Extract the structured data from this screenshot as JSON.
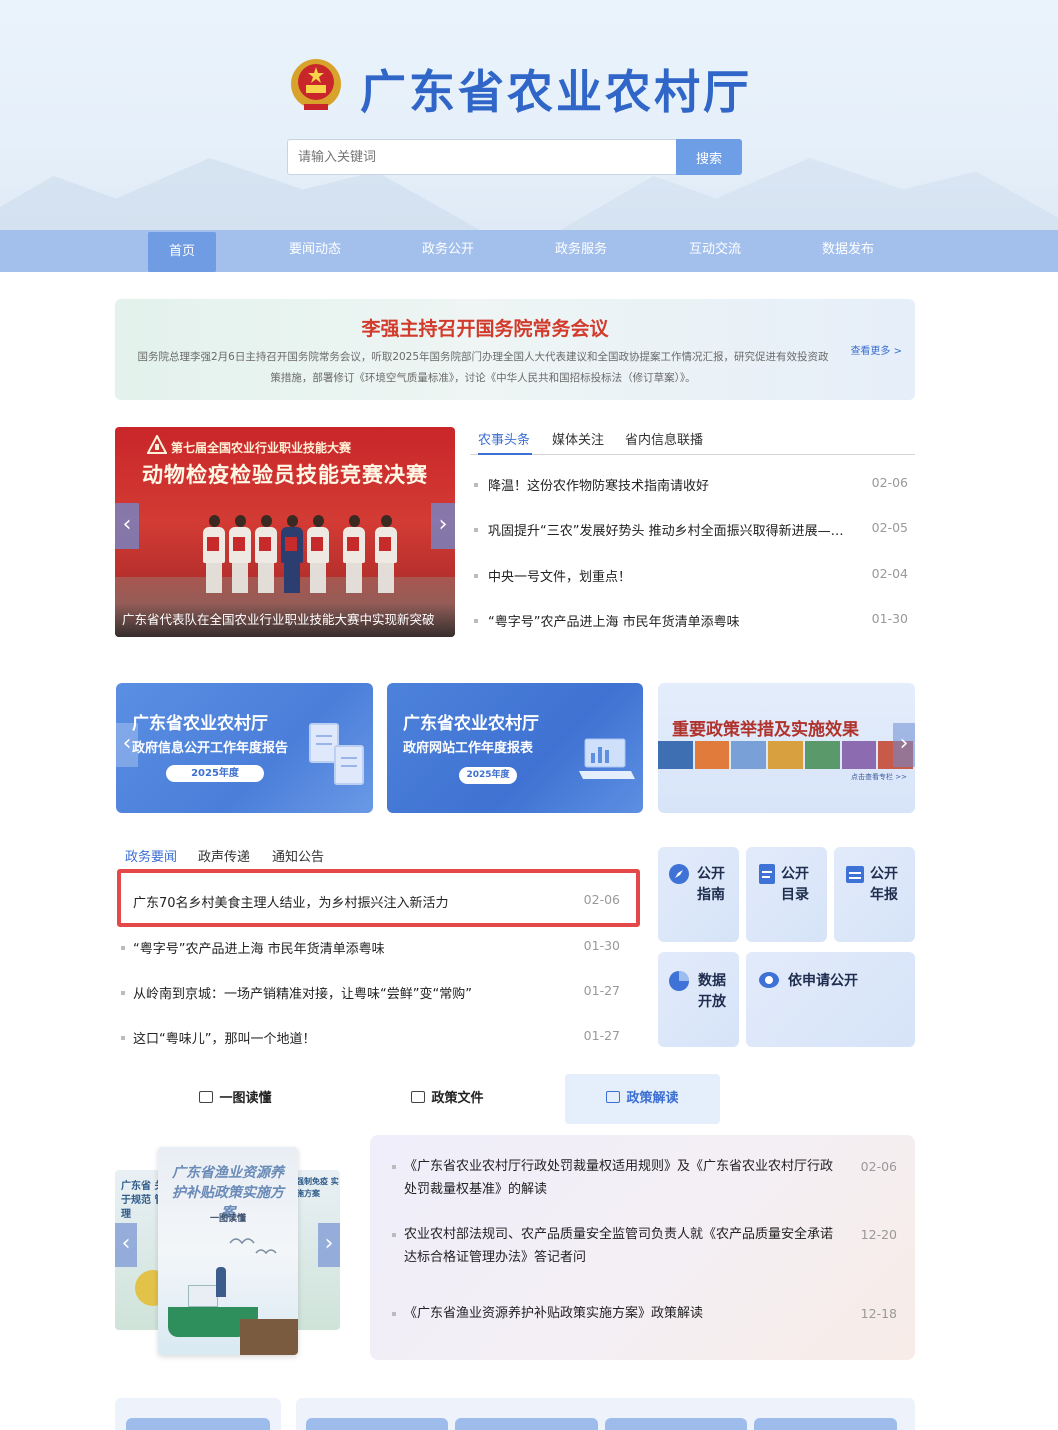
{
  "header": {
    "site_title": "广东省农业农村厅",
    "search_placeholder": "请输入关键词",
    "search_button": "搜索"
  },
  "nav": {
    "items": [
      {
        "label": "首页",
        "active": true
      },
      {
        "label": "要闻动态"
      },
      {
        "label": "政务公开"
      },
      {
        "label": "政务服务"
      },
      {
        "label": "互动交流"
      },
      {
        "label": "数据发布"
      }
    ]
  },
  "banner": {
    "title": "李强主持召开国务院常务会议",
    "desc": "国务院总理李强2月6日主持召开国务院常务会议，听取2025年国务院部门办理全国人大代表建议和全国政协提案工作情况汇报，研究促进有效投资政策措施，部署修订《环境空气质量标准》，讨论《中华人民共和国招标投标法（修订草案）》。",
    "more": "查看更多 >"
  },
  "slider1": {
    "subtitle": "第七届全国农业行业职业技能大赛",
    "title": "动物检疫检验员技能竞赛决赛",
    "caption": "广东省代表队在全国农业行业职业技能大赛中实现新突破"
  },
  "tabs1": {
    "items": [
      "农事头条",
      "媒体关注",
      "省内信息联播"
    ],
    "news": [
      {
        "title": "降温！这份农作物防寒技术指南请收好",
        "date": "02-06"
      },
      {
        "title": "巩固提升“三农”发展好势头 推动乡村全面振兴取得新进展—…",
        "date": "02-05"
      },
      {
        "title": "中央一号文件，划重点！",
        "date": "02-04"
      },
      {
        "title": "“粤字号”农产品进上海 市民年货清单添粤味",
        "date": "01-30"
      }
    ]
  },
  "cards": {
    "card1": {
      "title": "广东省农业农村厅",
      "sub": "政府信息公开工作年度报告",
      "pill": "2025年度"
    },
    "card2": {
      "title": "广东省农业农村厅",
      "sub": "政府网站工作年度报表",
      "pill": "2025年度"
    },
    "card3": {
      "title": "重要政策举措及实施效果",
      "more": "点击查看专栏 >>"
    }
  },
  "tabs2": {
    "items": [
      "政务要闻",
      "政声传递",
      "通知公告"
    ],
    "news": [
      {
        "title": "广东70名乡村美食主理人结业，为乡村振兴注入新活力",
        "date": "02-06"
      },
      {
        "title": "“粤字号”农产品进上海 市民年货清单添粤味",
        "date": "01-30"
      },
      {
        "title": "从岭南到京城：一场产销精准对接，让粤味“尝鲜”变“常购”",
        "date": "01-27"
      },
      {
        "title": "这口“粤味儿”，那叫一个地道！",
        "date": "01-27"
      }
    ]
  },
  "tiles": {
    "guide": [
      "公开",
      "指南"
    ],
    "catalog": [
      "公开",
      "目录"
    ],
    "annual": [
      "公开",
      "年报"
    ],
    "data": [
      "数据",
      "开放"
    ],
    "apply": "依申请公开"
  },
  "tabs3": {
    "items": [
      "一图读懂",
      "政策文件",
      "政策解读"
    ]
  },
  "slider2": {
    "center_title": "广东省渔业资源养护补贴政策实施方案",
    "center_sub": "一图读懂",
    "left_text": "广东省 关于规范 管理",
    "right_text": "强制免疫 实施方案"
  },
  "policies": [
    {
      "title": "《广东省农业农村厅行政处罚裁量权适用规则》及《广东省农业农村厅行政处罚裁量权基准》的解读",
      "date": "02-06"
    },
    {
      "title": "农业农村部法规司、农产品质量安全监管司负责人就《农产品质量安全承诺达标合格证管理办法》答记者问",
      "date": "12-20"
    },
    {
      "title": "《广东省渔业资源养护补贴政策实施方案》政策解读",
      "date": "12-18"
    }
  ],
  "colors": {
    "brand": "#2f66c8",
    "nav": "#a3c0ec",
    "nav_active": "#6f9ce2",
    "headline_red": "#d23a2c",
    "highlight_border": "#e54848"
  }
}
